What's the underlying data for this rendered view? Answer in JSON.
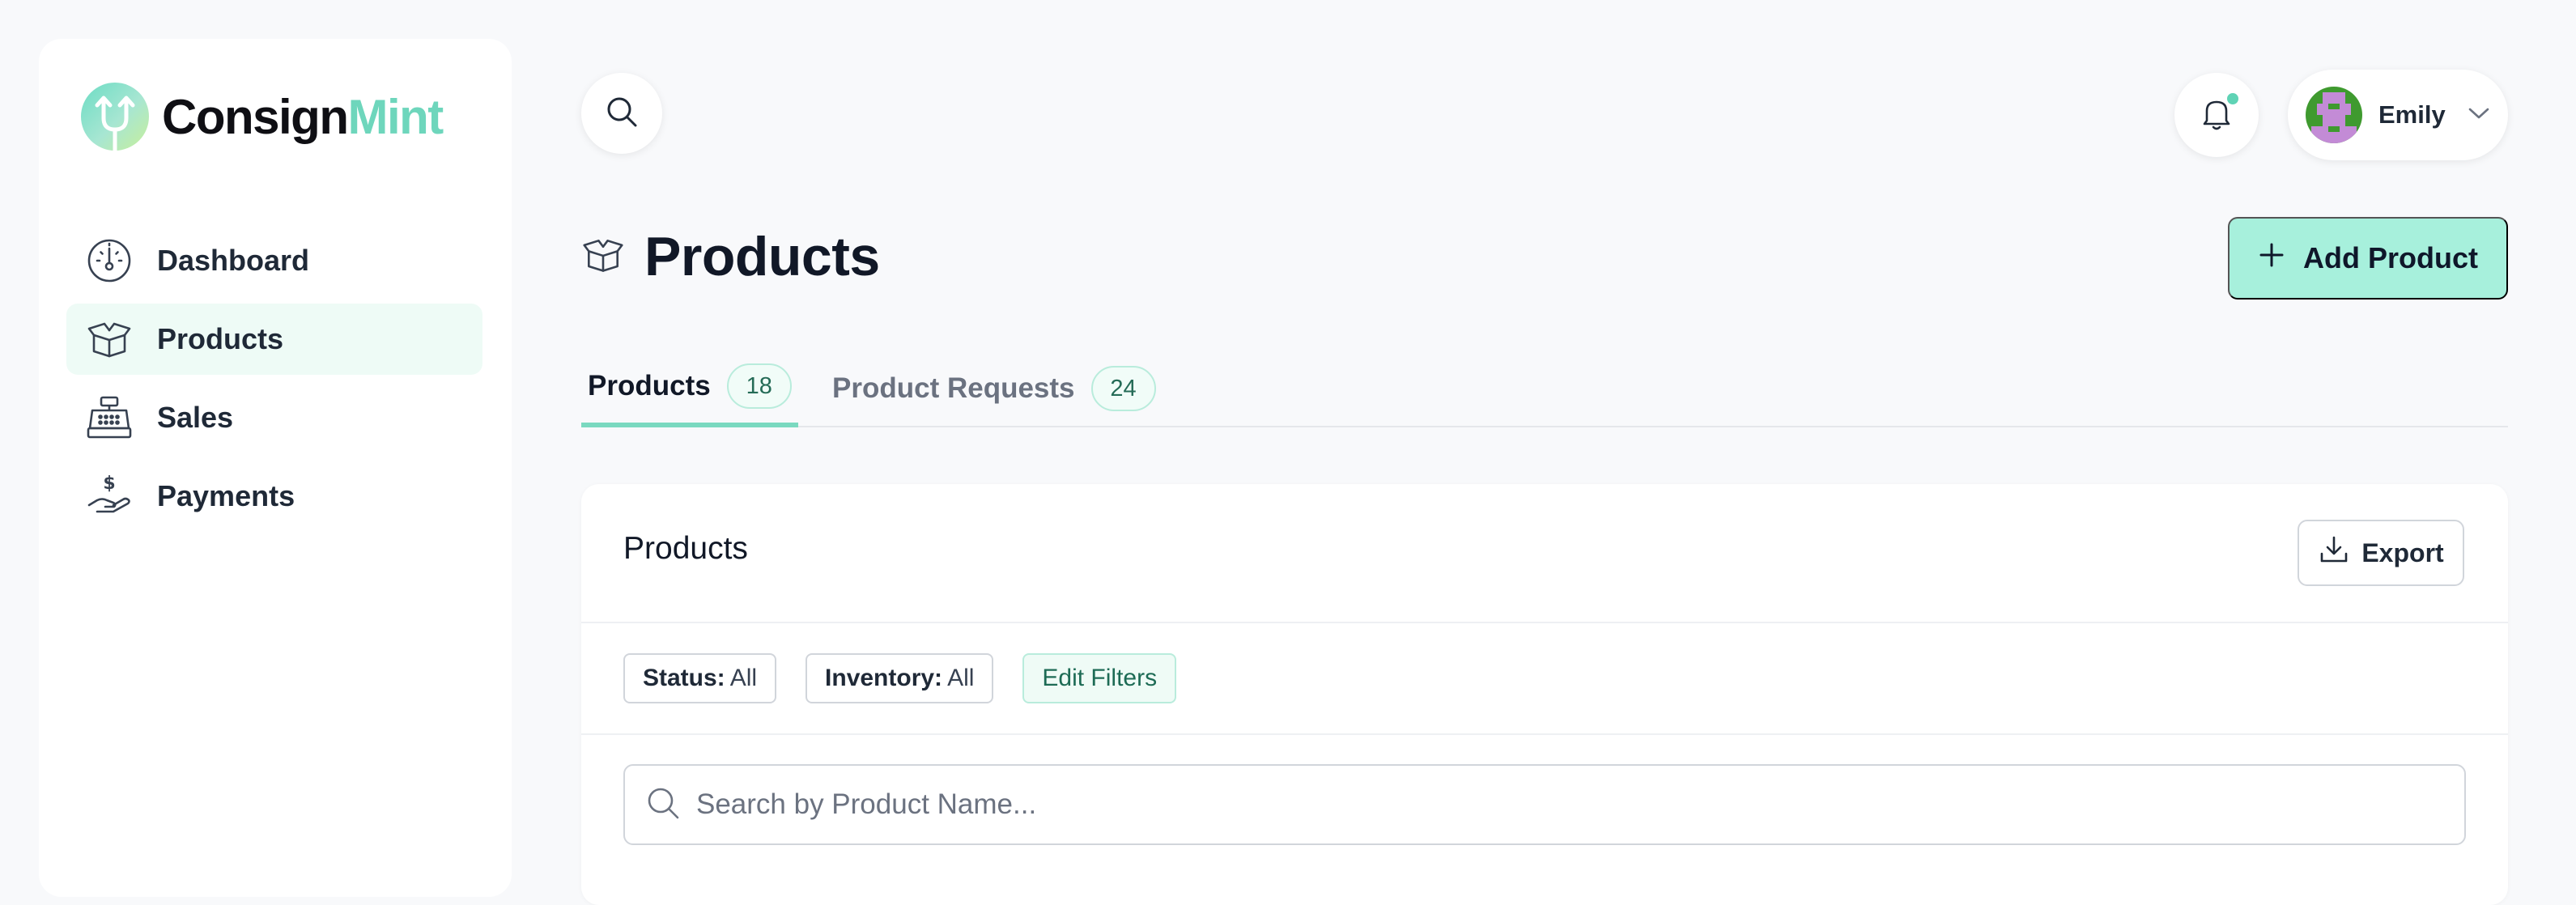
{
  "app": {
    "logo_part1": "Consign",
    "logo_part2": "Mint",
    "accent_color": "#6ed6bc"
  },
  "sidebar": {
    "items": [
      {
        "label": "Dashboard",
        "icon": "gauge-icon",
        "active": false
      },
      {
        "label": "Products",
        "icon": "open-box-icon",
        "active": true
      },
      {
        "label": "Sales",
        "icon": "cash-register-icon",
        "active": false
      },
      {
        "label": "Payments",
        "icon": "hand-dollar-icon",
        "active": false
      }
    ]
  },
  "topbar": {
    "search_icon": "search-icon",
    "notifications_icon": "bell-icon",
    "user_name": "Emily"
  },
  "page": {
    "title": "Products",
    "add_button": "Add Product"
  },
  "tabs": [
    {
      "label": "Products",
      "count": "18",
      "active": true
    },
    {
      "label": "Product Requests",
      "count": "24",
      "active": false
    }
  ],
  "card": {
    "title": "Products",
    "export_label": "Export",
    "filters": [
      {
        "key": "Status:",
        "value": "All"
      },
      {
        "key": "Inventory:",
        "value": "All"
      }
    ],
    "edit_filters": "Edit Filters",
    "search_placeholder": "Search by Product Name..."
  }
}
